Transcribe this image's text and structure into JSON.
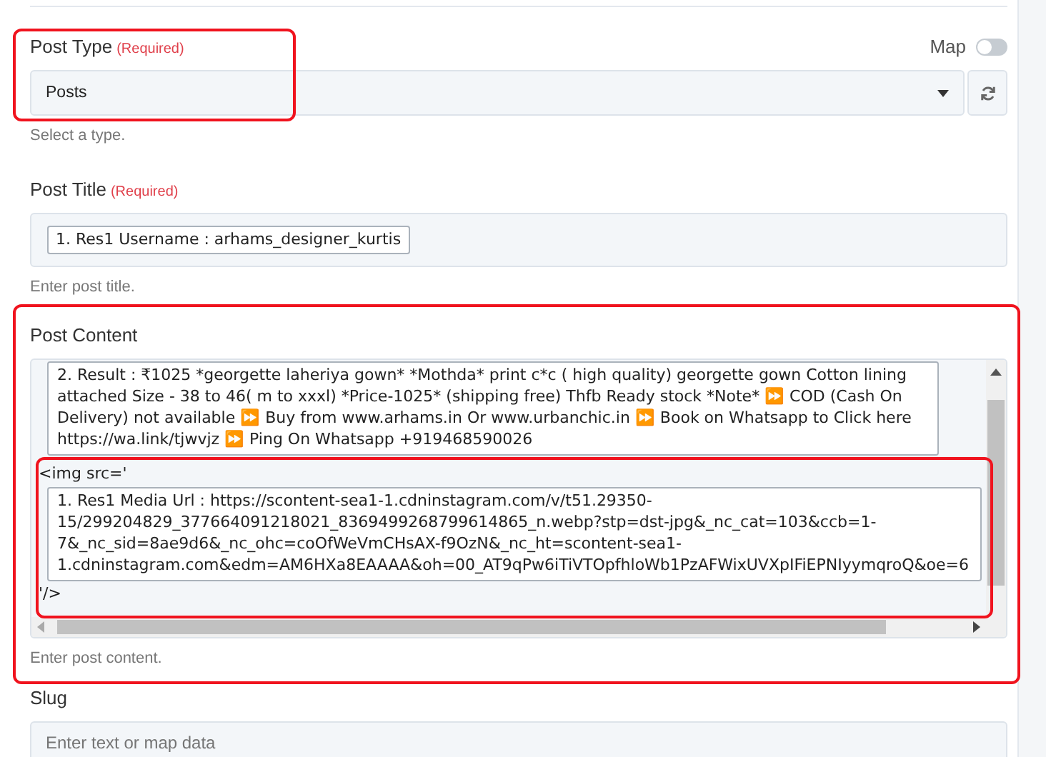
{
  "fields": [
    {
      "kind": "select",
      "label": "Post Type",
      "required_note": "(Required)",
      "map": {
        "label": "Map",
        "on": false
      },
      "value": "Posts",
      "hint": "Select a type."
    },
    {
      "kind": "tokens",
      "label": "Post Title",
      "required_note": "(Required)",
      "tokens": [
        "1. Res1 Username : arhams_designer_kurtis"
      ],
      "hint": "Enter post title."
    },
    {
      "kind": "content",
      "label": "Post Content",
      "parts": [
        {
          "kind": "token",
          "text": "2. Result : ₹1025 *georgette laheriya gown* *Mothda* print c*c ( high quality) georgette gown Cotton lining attached Size - 38 to 46( m to xxxl) *Price-1025* (shipping free) Thfb Ready stock *Note* ⏩ COD (Cash On Delivery) not available ⏩ Buy from www.arhams.in Or www.urbanchic.in ⏩ Book on Whatsapp to Click here https://wa.link/tjwvjz ⏩ Ping On Whatsapp +919468590026"
        },
        {
          "kind": "text",
          "text": "<img src='"
        },
        {
          "kind": "token",
          "text": "1. Res1 Media Url : https://scontent-sea1-1.cdninstagram.com/v/t51.29350-15/299204829_377664091218021_8369499268799614865_n.webp?stp=dst-jpg&_nc_cat=103&ccb=1-7&_nc_sid=8ae9d6&_nc_ohc=coOfWeVmCHsAX-f9OzN&_nc_ht=scontent-sea1-1.cdninstagram.com&edm=AM6HXa8EAAAA&oh=00_AT9qPw6iTiVTOpfhloWb1PzAFWixUVXpIFiEPNIyymqroQ&oe=6"
        },
        {
          "kind": "text",
          "text": "'/>"
        }
      ],
      "hint": "Enter post content."
    },
    {
      "kind": "text",
      "label": "Slug",
      "placeholder": "Enter text or map data"
    }
  ]
}
